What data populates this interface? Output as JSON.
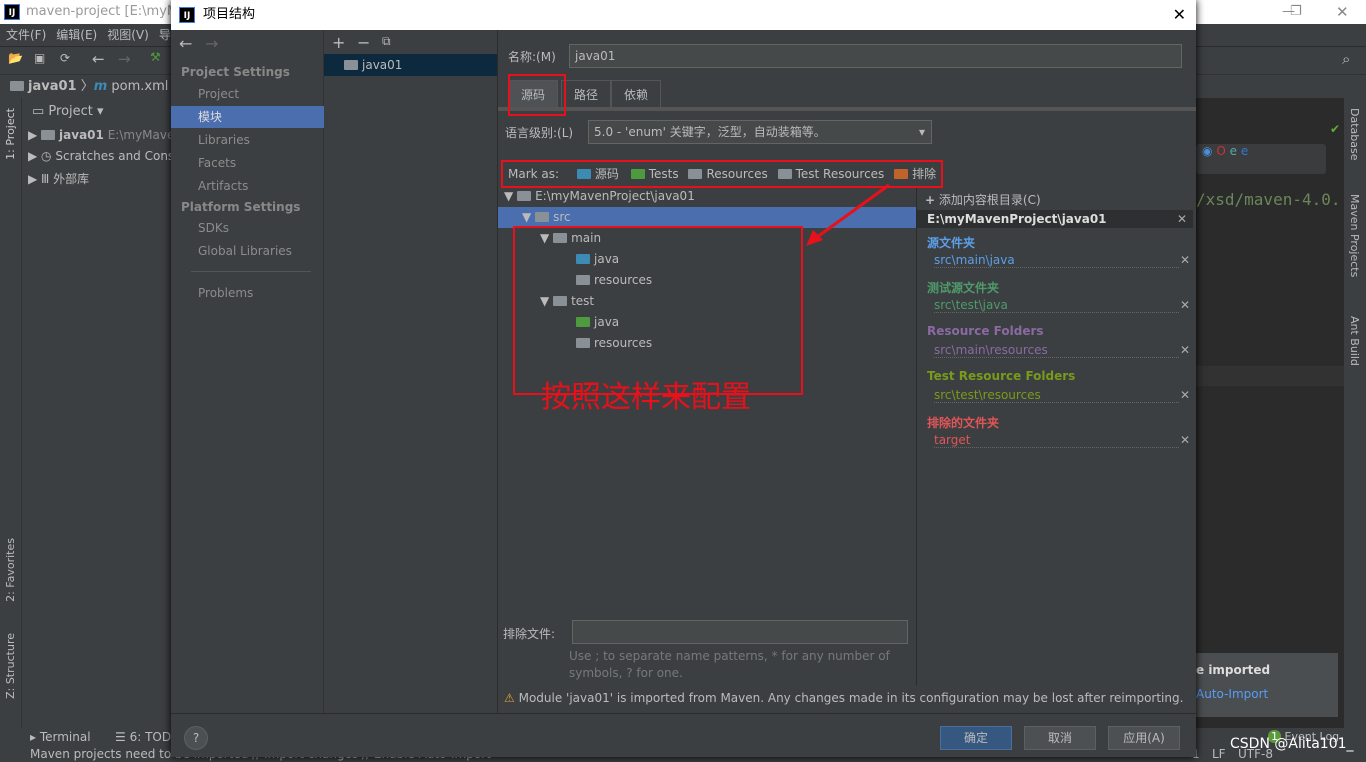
{
  "ide": {
    "title": "maven-project [E:\\myMav",
    "menu": [
      "文件(F)",
      "编辑(E)",
      "视图(V)",
      "导"
    ],
    "breadcrumb": [
      "java01",
      "pom.xml"
    ],
    "project_panel": {
      "label": "Project",
      "items": [
        {
          "name": "java01",
          "path": "E:\\myMave"
        },
        {
          "name": "Scratches and Cons"
        },
        {
          "name": "外部库"
        }
      ]
    },
    "left_tools": [
      "1: Project",
      "2: Favorites",
      "Z: Structure"
    ],
    "right_tools": [
      "Database",
      "Maven Projects",
      "Ant Build"
    ],
    "editor_snippet": "/xsd/maven-4.0.",
    "notification": {
      "title": "e imported",
      "link": "Auto-Import"
    },
    "bottom_tabs": [
      "Terminal",
      "6: TODO"
    ],
    "event_log": "Event Log",
    "event_count": "1",
    "status": "Maven projects need to be imported // Import changes // Enable Auto-Import",
    "status_right": [
      "1",
      "LF",
      "UTF-8"
    ],
    "watermark": "CSDN @Alita101_"
  },
  "dialog": {
    "title": "项目结构",
    "nav": {
      "project_settings": "Project Settings",
      "ps_items": [
        "Project",
        "模块",
        "Libraries",
        "Facets",
        "Artifacts"
      ],
      "platform_settings": "Platform Settings",
      "pl_items": [
        "SDKs",
        "Global Libraries"
      ],
      "problems": "Problems",
      "selected": "模块"
    },
    "modules": [
      "java01"
    ],
    "name_label": "名称:(M)",
    "name_value": "java01",
    "tabs": [
      "源码",
      "路径",
      "依赖"
    ],
    "active_tab": "源码",
    "lang_label": "语言级别:(L)",
    "lang_value": "5.0 - 'enum' 关键字，泛型，自动装箱等。",
    "mark_as": {
      "label": "Mark as:",
      "items": [
        {
          "label": "源码",
          "color": "#3d8ab5"
        },
        {
          "label": "Tests",
          "color": "#4e9a3e"
        },
        {
          "label": "Resources",
          "color": "#8a9196"
        },
        {
          "label": "Test Resources",
          "color": "#8a9196"
        },
        {
          "label": "排除",
          "color": "#c0632b"
        }
      ]
    },
    "tree": [
      {
        "label": "E:\\myMavenProject\\java01",
        "depth": 0,
        "arrow": true,
        "color": "#8a9196"
      },
      {
        "label": "src",
        "depth": 1,
        "arrow": true,
        "color": "#8a9196",
        "selected": true
      },
      {
        "label": "main",
        "depth": 2,
        "arrow": true,
        "color": "#8a9196"
      },
      {
        "label": "java",
        "depth": 3,
        "color": "#3d8ab5"
      },
      {
        "label": "resources",
        "depth": 3,
        "color": "#8a9196"
      },
      {
        "label": "test",
        "depth": 2,
        "arrow": true,
        "color": "#8a9196"
      },
      {
        "label": "java",
        "depth": 3,
        "color": "#4e9a3e"
      },
      {
        "label": "resources",
        "depth": 3,
        "color": "#8a9196"
      }
    ],
    "annotation": "按照这样来配置",
    "exclude_label": "排除文件:",
    "exclude_value": "",
    "exclude_hint": "Use ; to separate name patterns, * for any number of symbols, ? for one.",
    "add_root": "添加内容根目录(C)",
    "root_path": "E:\\myMavenProject\\java01",
    "roots": [
      {
        "heading": "源文件夹",
        "path": "src\\main\\java",
        "color": "#5c9ee8"
      },
      {
        "heading": "测试源文件夹",
        "path": "src\\test\\java",
        "color": "#4e9a6a"
      },
      {
        "heading": "Resource Folders",
        "path": "src\\main\\resources",
        "color": "#8a6aa3"
      },
      {
        "heading": "Test Resource Folders",
        "path": "src\\test\\resources",
        "color": "#7a9a1a"
      },
      {
        "heading": "排除的文件夹",
        "path": "target",
        "color": "#e05555"
      }
    ],
    "warning": "Module 'java01' is imported from Maven. Any changes made in its configuration may be lost after reimporting.",
    "ok": "确定",
    "cancel": "取消",
    "apply": "应用(A)",
    "help": "?"
  }
}
